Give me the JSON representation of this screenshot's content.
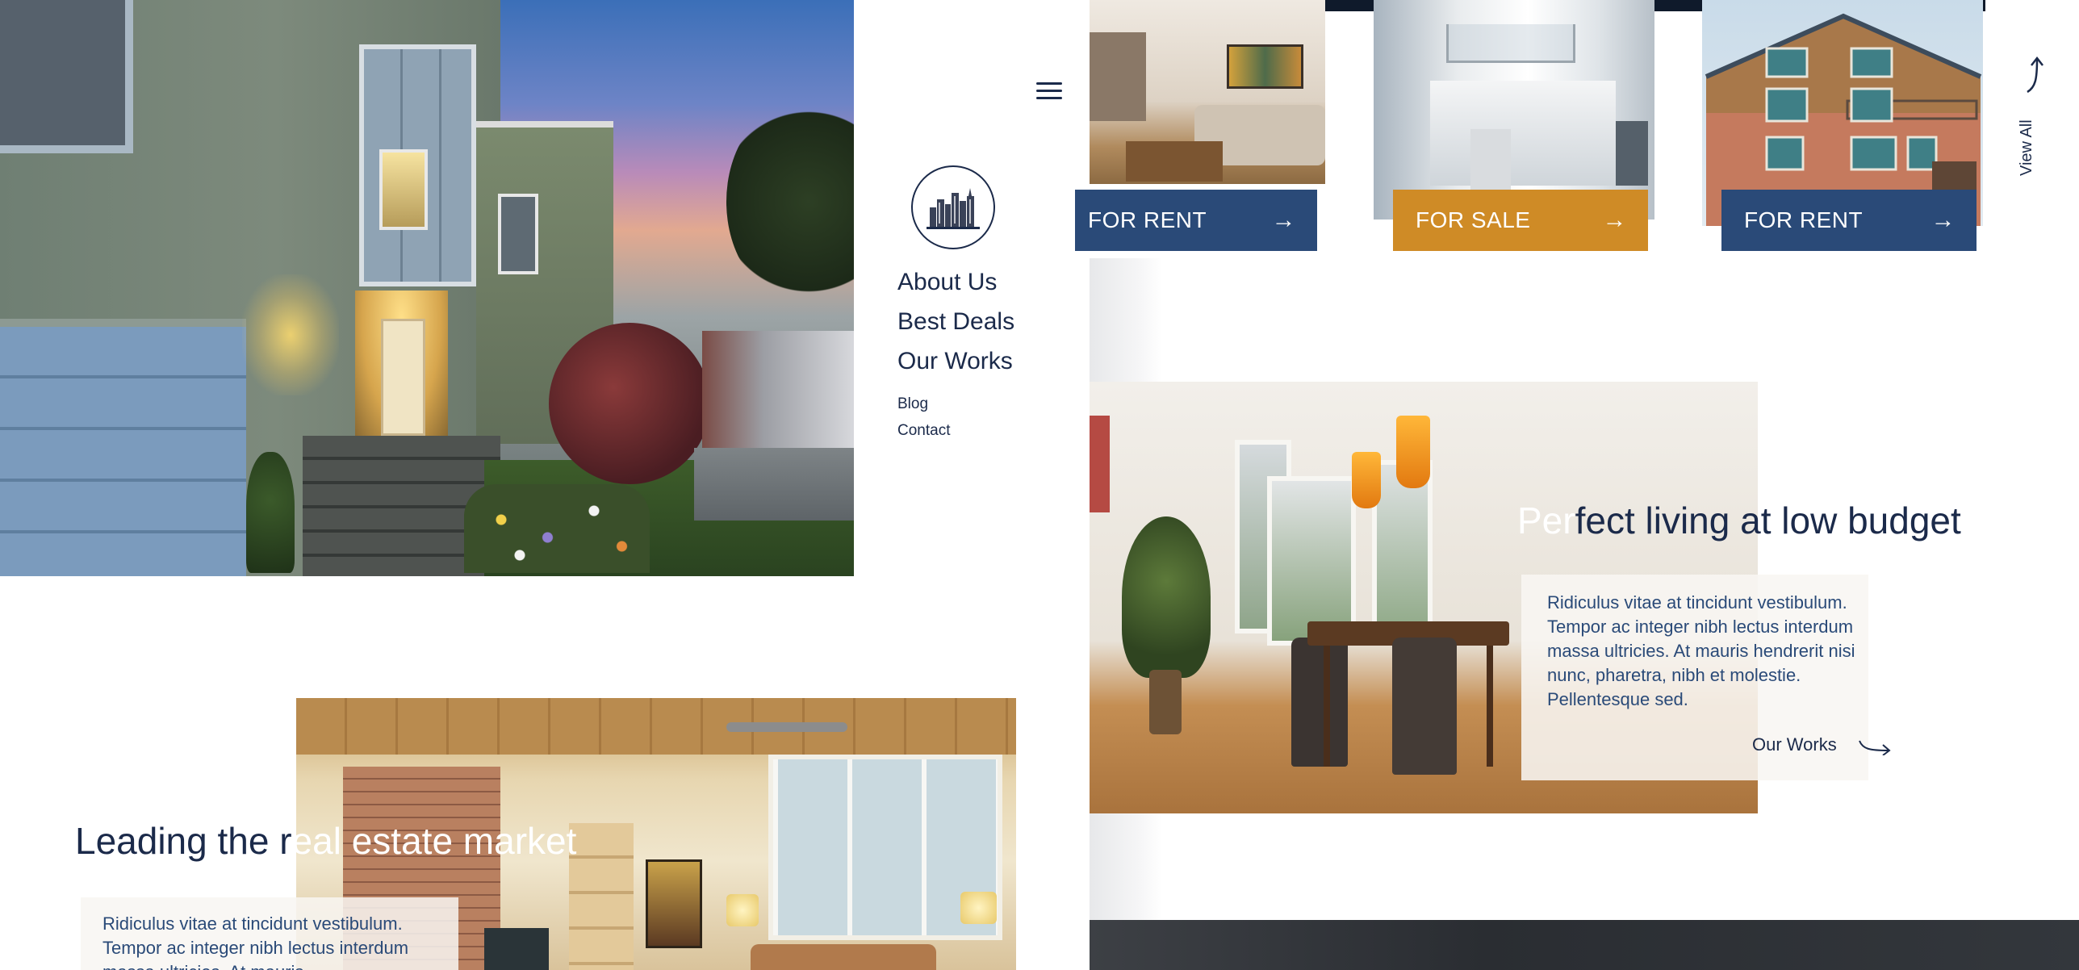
{
  "nav": {
    "menu_icon": "hamburger-menu-icon",
    "logo_icon": "city-skyline-logo",
    "primary_links": [
      "About Us",
      "Best Deals",
      "Our Works"
    ],
    "secondary_links": [
      "Blog",
      "Contact"
    ]
  },
  "listings": [
    {
      "status": "FOR RENT",
      "color": "#2a4a78",
      "arrow_icon": "arrow-right-icon"
    },
    {
      "status": "FOR SALE",
      "color": "#cf8b26",
      "arrow_icon": "arrow-right-icon"
    },
    {
      "status": "FOR RENT",
      "color": "#2a4a78",
      "arrow_icon": "arrow-right-icon"
    }
  ],
  "view_all": {
    "label": "View All",
    "icon": "curved-arrow-up-icon"
  },
  "feature_right": {
    "title_part1": "Per",
    "title_part2": "fect living at low budget",
    "description": "Ridiculus vitae at tincidunt vestibulum. Tempor ac integer nibh lectus interdum massa ultricies. At mauris hendrerit nisi nunc, pharetra, nibh et molestie. Pellentesque sed.",
    "link_label": "Our Works",
    "link_icon": "long-arrow-right-icon"
  },
  "feature_left": {
    "title_part1": "Leading the r",
    "title_part2": "eal estate market",
    "description": "Ridiculus vitae at tincidunt vestibulum. Tempor ac integer nibh lectus interdum massa ultricies. At mauris"
  },
  "colors": {
    "navy": "#1b2a4a",
    "button_blue": "#2a4a78",
    "button_gold": "#cf8b26"
  }
}
